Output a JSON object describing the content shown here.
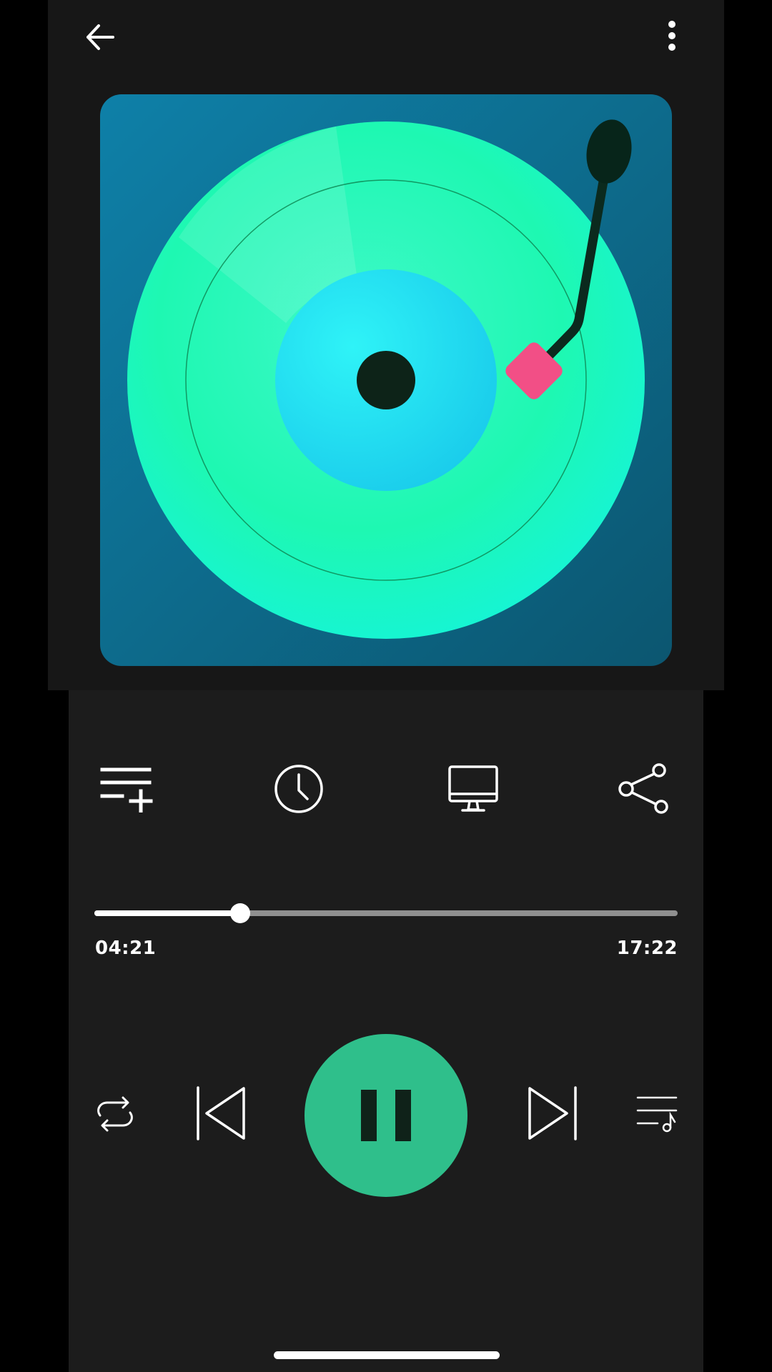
{
  "header": {
    "back_icon": "arrow-left-icon",
    "menu_icon": "more-vertical-icon"
  },
  "artwork": {
    "description_icon": "vinyl-turntable-artwork"
  },
  "actions": [
    {
      "name": "add-to-playlist",
      "icon": "playlist-add-icon"
    },
    {
      "name": "sleep-timer",
      "icon": "clock-icon"
    },
    {
      "name": "cast",
      "icon": "monitor-icon"
    },
    {
      "name": "share",
      "icon": "share-icon"
    }
  ],
  "progress": {
    "elapsed": "04:21",
    "total": "17:22",
    "fraction": 0.25
  },
  "controls": {
    "repeat_icon": "repeat-icon",
    "prev_icon": "skip-previous-icon",
    "play_pause_icon": "pause-icon",
    "next_icon": "skip-next-icon",
    "queue_icon": "queue-music-icon"
  },
  "colors": {
    "accent": "#2fbf8b",
    "background": "#1c1c1c",
    "artwork_bg": "#0e6e8c",
    "disc": "#1cf5b0",
    "needle_head": "#f24f86"
  }
}
